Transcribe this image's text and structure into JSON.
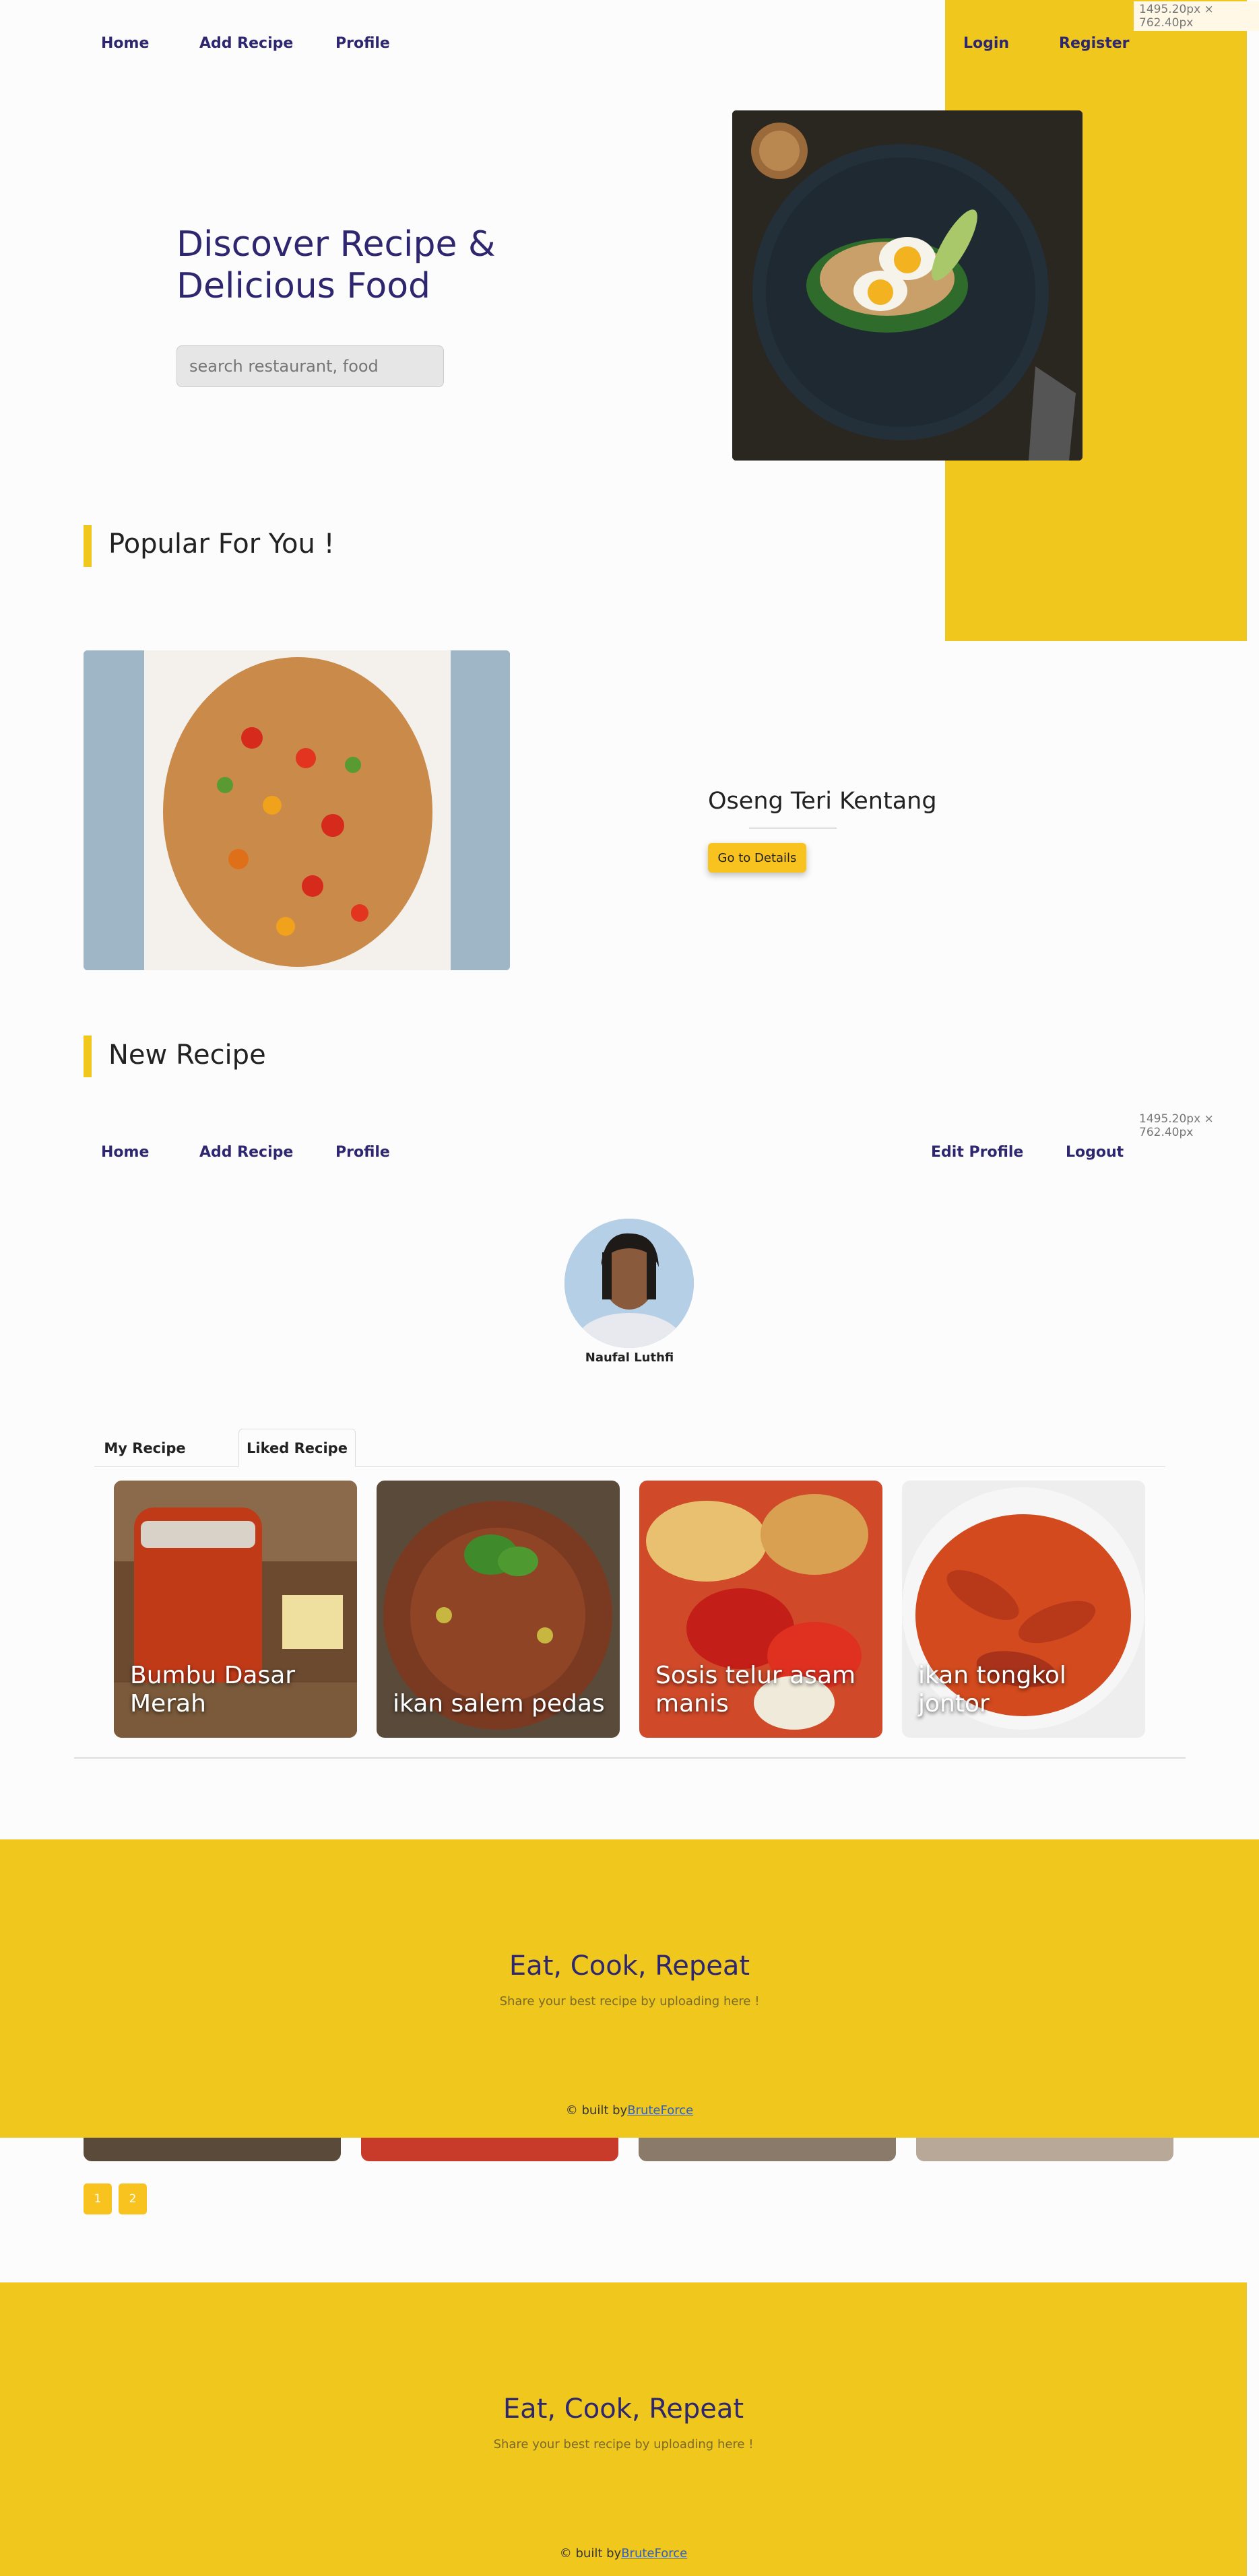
{
  "landing": {
    "nav": {
      "home": "Home",
      "add_recipe": "Add Recipe",
      "profile": "Profile",
      "login": "Login",
      "register": "Register"
    },
    "dimensions_label": "1495.20px × 762.40px",
    "hero": {
      "title_line1": "Discover Recipe &",
      "title_line2": "Delicious Food",
      "search_placeholder": "search restaurant, food"
    },
    "popular": {
      "heading": "Popular For You !",
      "recipe_name": "Oseng Teri Kentang",
      "details_button": "Go to Details"
    },
    "new_recipe": {
      "heading": "New Recipe"
    },
    "pagination": [
      "1",
      "2"
    ]
  },
  "profile_page": {
    "dimensions_label": "1495.20px × 762.40px",
    "nav": {
      "home": "Home",
      "add_recipe": "Add Recipe",
      "profile": "Profile",
      "edit_profile": "Edit Profile",
      "logout": "Logout"
    },
    "user_name": "Naufal Luthfi",
    "tabs": [
      {
        "label": "My Recipe",
        "active": false
      },
      {
        "label": "Liked Recipe",
        "active": true
      }
    ],
    "cards": [
      {
        "title": "Bumbu Dasar Merah"
      },
      {
        "title": "ikan salem pedas"
      },
      {
        "title": "Sosis telur asam manis"
      },
      {
        "title": "ikan tongkol jontor"
      }
    ]
  },
  "footer": {
    "title": "Eat, Cook, Repeat",
    "subtitle": "Share your best recipe by uploading here !",
    "credit_prefix": "© built by",
    "credit_link": "BruteForce"
  },
  "colors": {
    "accent": "#efc71d",
    "nav_text": "#2e266f",
    "button": "#f9c31f"
  }
}
